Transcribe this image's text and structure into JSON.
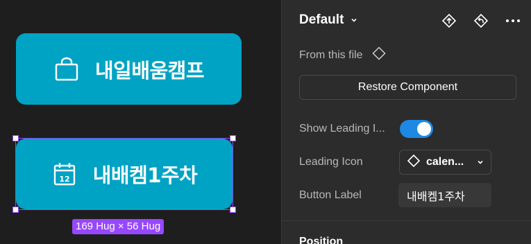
{
  "canvas": {
    "button1": {
      "label": "내일배움캠프",
      "icon": "shopping-bag-icon"
    },
    "button2": {
      "label": "내배켐1주차",
      "icon": "calendar-icon"
    },
    "size_badge": "169 Hug × 56 Hug",
    "colors": {
      "button_bg": "#00a3c4",
      "selection": "#9747ff"
    }
  },
  "panel": {
    "variant": "Default",
    "top_icons": [
      "go-to-main-component-icon",
      "reset-icon",
      "more-icon"
    ],
    "from_file": "From this file",
    "restore_label": "Restore Component",
    "properties": {
      "show_leading_label": "Show Leading I...",
      "show_leading_value": true,
      "leading_icon_label": "Leading Icon",
      "leading_icon_value": "calen...",
      "button_label_label": "Button Label",
      "button_label_value": "내배켐1주차"
    },
    "section_position": "Position",
    "colors": {
      "toggle_on": "#1e88e5"
    }
  }
}
